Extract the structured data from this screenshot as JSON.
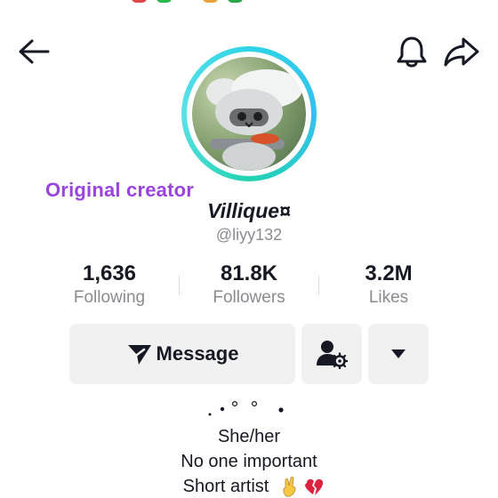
{
  "header": {
    "back_icon": "arrow-left-icon",
    "notification_icon": "bell-icon",
    "share_icon": "share-arrow-icon"
  },
  "overlay": {
    "original_creator": "Original creator"
  },
  "profile": {
    "display_name": "Villique¤",
    "username": "@liyy132",
    "avatar_ring_color": "#2fd5e6"
  },
  "stats": [
    {
      "value": "1,636",
      "label": "Following"
    },
    {
      "value": "81.8K",
      "label": "Followers"
    },
    {
      "value": "3.2M",
      "label": "Likes"
    }
  ],
  "actions": {
    "message_label": "Message",
    "add_friend_icon": "person-gear-icon",
    "more_icon": "caret-down-icon"
  },
  "bio": {
    "decoration": ". • ° ° •",
    "lines": [
      "She/her",
      "No one important",
      "Short artist"
    ],
    "emojis": [
      "victory-hand-icon",
      "broken-heart-icon"
    ]
  },
  "colors": {
    "accent_purple": "#9a44e0",
    "text_primary": "#161823",
    "text_secondary": "#8a8b91",
    "button_bg": "#f1f1f2"
  }
}
